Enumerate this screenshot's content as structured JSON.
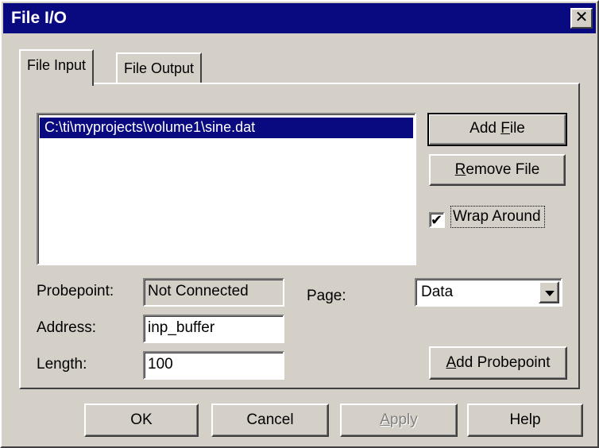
{
  "window": {
    "title": "File I/O",
    "close_glyph": "✕"
  },
  "tabs": [
    {
      "label": "File Input",
      "active": true
    },
    {
      "label": "File Output",
      "active": false
    }
  ],
  "file_list": {
    "items": [
      "C:\\ti\\myprojects\\volume1\\sine.dat"
    ],
    "selected_index": 0
  },
  "buttons": {
    "add_file": {
      "pre": "Add ",
      "mnemonic": "F",
      "post": "ile"
    },
    "remove_file": {
      "pre": "",
      "mnemonic": "R",
      "post": "emove File"
    },
    "add_probepoint": {
      "pre": "",
      "mnemonic": "A",
      "post": "dd Probepoint"
    }
  },
  "wrap_around": {
    "label": "Wrap Around",
    "checked": true
  },
  "probepoint": {
    "label": "Probepoint:",
    "value": "Not Connected"
  },
  "page": {
    "label": "Page:",
    "value": "Data"
  },
  "address": {
    "label": "Address:",
    "value": "inp_buffer"
  },
  "length": {
    "label": "Length:",
    "value": "100"
  },
  "footer": {
    "ok": "OK",
    "cancel": "Cancel",
    "apply": {
      "pre": "",
      "mnemonic": "A",
      "post": "pply",
      "enabled": false
    },
    "help": "Help"
  }
}
